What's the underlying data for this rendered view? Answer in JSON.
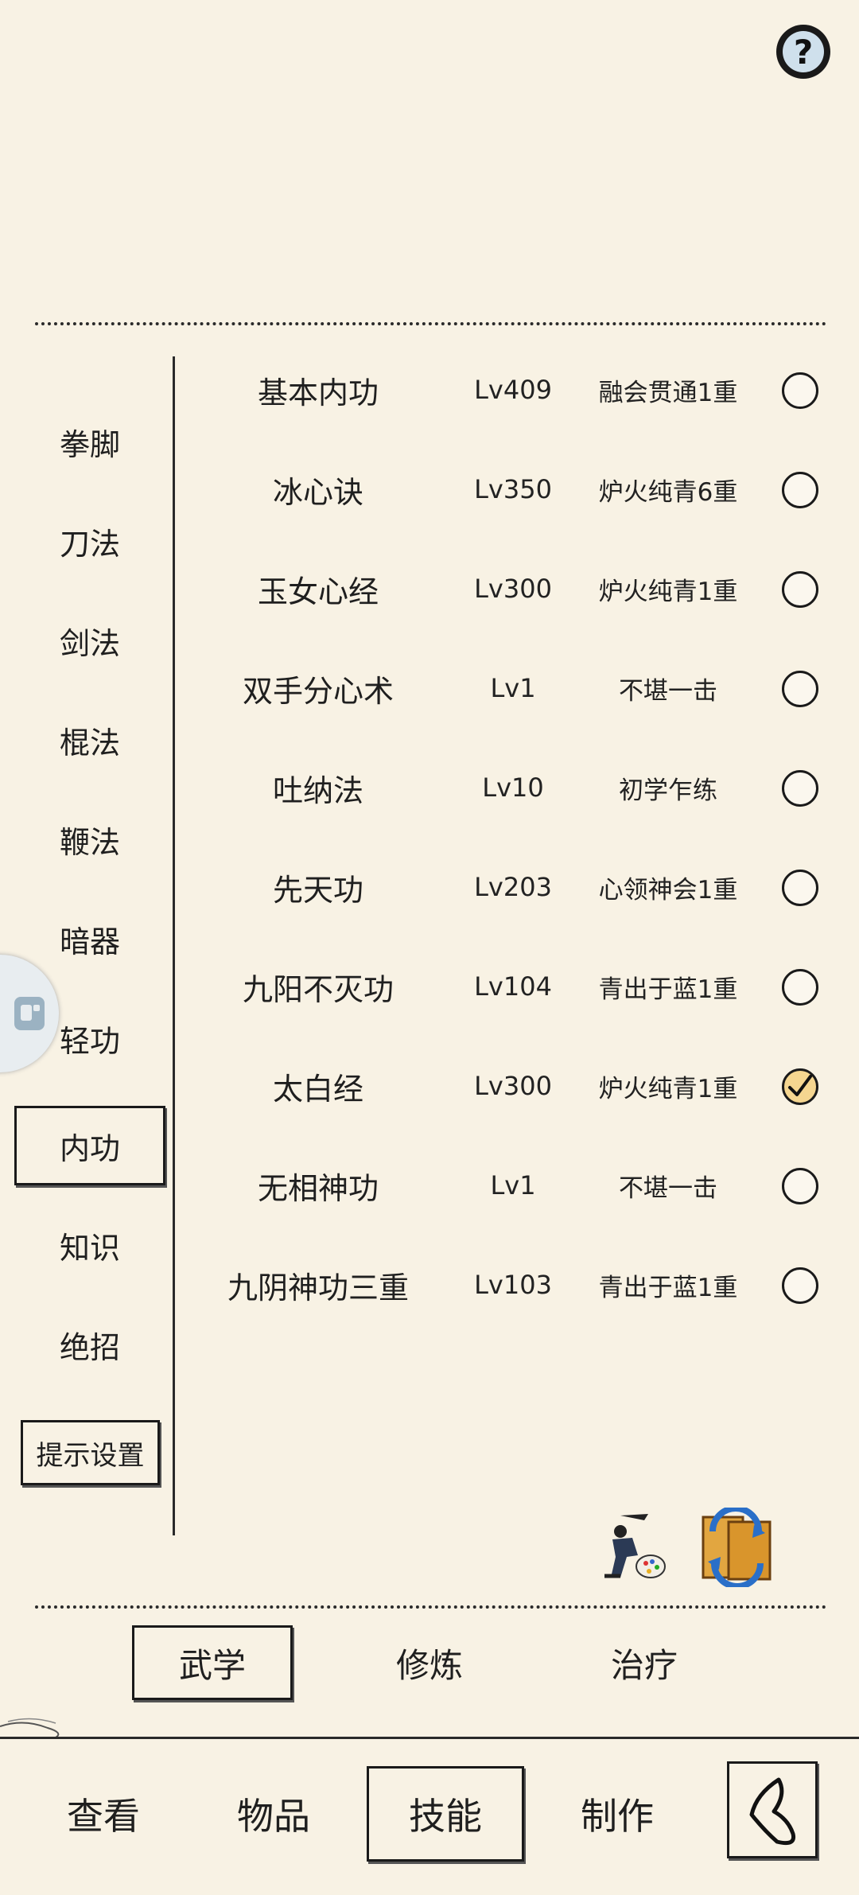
{
  "help": {
    "glyph": "?"
  },
  "sidebar": {
    "items": [
      {
        "label": "拳脚",
        "active": false
      },
      {
        "label": "刀法",
        "active": false
      },
      {
        "label": "剑法",
        "active": false
      },
      {
        "label": "棍法",
        "active": false
      },
      {
        "label": "鞭法",
        "active": false
      },
      {
        "label": "暗器",
        "active": false
      },
      {
        "label": "轻功",
        "active": false
      },
      {
        "label": "内功",
        "active": true
      },
      {
        "label": "知识",
        "active": false
      },
      {
        "label": "绝招",
        "active": false
      }
    ],
    "hint_button": "提示设置"
  },
  "skills": [
    {
      "name": "基本内功",
      "level": "Lv409",
      "rank": "融会贯通1重",
      "checked": false
    },
    {
      "name": "冰心诀",
      "level": "Lv350",
      "rank": "炉火纯青6重",
      "checked": false
    },
    {
      "name": "玉女心经",
      "level": "Lv300",
      "rank": "炉火纯青1重",
      "checked": false
    },
    {
      "name": "双手分心术",
      "level": "Lv1",
      "rank": "不堪一击",
      "checked": false
    },
    {
      "name": "吐纳法",
      "level": "Lv10",
      "rank": "初学乍练",
      "checked": false
    },
    {
      "name": "先天功",
      "level": "Lv203",
      "rank": "心领神会1重",
      "checked": false
    },
    {
      "name": "九阳不灭功",
      "level": "Lv104",
      "rank": "青出于蓝1重",
      "checked": false
    },
    {
      "name": "太白经",
      "level": "Lv300",
      "rank": "炉火纯青1重",
      "checked": true
    },
    {
      "name": "无相神功",
      "level": "Lv1",
      "rank": "不堪一击",
      "checked": false
    },
    {
      "name": "九阴神功三重",
      "level": "Lv103",
      "rank": "青出于蓝1重",
      "checked": false
    }
  ],
  "bottom_icons": [
    "swordsman-palette-icon",
    "scroll-exchange-icon"
  ],
  "subtabs": [
    {
      "label": "武学",
      "active": true
    },
    {
      "label": "修炼",
      "active": false
    },
    {
      "label": "治疗",
      "active": false
    }
  ],
  "nav": [
    {
      "label": "查看",
      "active": false
    },
    {
      "label": "物品",
      "active": false
    },
    {
      "label": "技能",
      "active": true
    },
    {
      "label": "制作",
      "active": false
    }
  ],
  "colors": {
    "background": "#f8f2e4",
    "check_fill": "#f5d690",
    "ink": "#1a1a1a"
  }
}
